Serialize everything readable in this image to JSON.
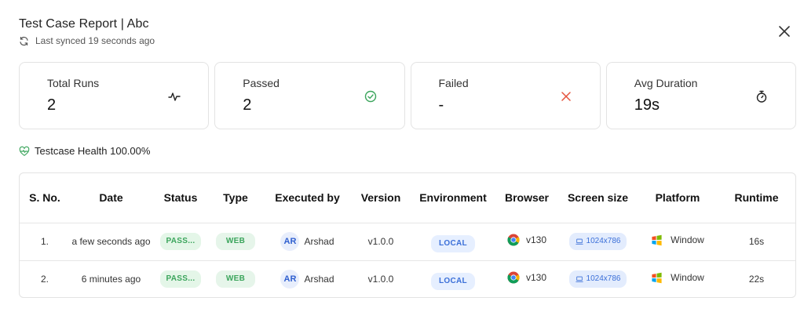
{
  "header": {
    "title": "Test Case Report | Abc",
    "sync_text": "Last synced 19 seconds ago"
  },
  "cards": [
    {
      "label": "Total Runs",
      "value": "2",
      "icon": "activity-icon"
    },
    {
      "label": "Passed",
      "value": "2",
      "icon": "check-circle-icon"
    },
    {
      "label": "Failed",
      "value": "-",
      "icon": "x-icon"
    },
    {
      "label": "Avg Duration",
      "value": "19s",
      "icon": "stopwatch-icon"
    }
  ],
  "health": {
    "text": "Testcase Health 100.00%"
  },
  "table": {
    "headers": [
      "S. No.",
      "Date",
      "Status",
      "Type",
      "Executed by",
      "Version",
      "Environment",
      "Browser",
      "Screen size",
      "Platform",
      "Runtime"
    ],
    "rows": [
      {
        "sno": "1.",
        "date": "a few seconds ago",
        "status": "PASS...",
        "type": "WEB",
        "avatar": "AR",
        "executed_by": "Arshad",
        "version": "v1.0.0",
        "environment": "LOCAL",
        "browser": "v130",
        "screen_size": "1024x786",
        "platform": "Window",
        "runtime": "16s"
      },
      {
        "sno": "2.",
        "date": "6 minutes ago",
        "status": "PASS...",
        "type": "WEB",
        "avatar": "AR",
        "executed_by": "Arshad",
        "version": "v1.0.0",
        "environment": "LOCAL",
        "browser": "v130",
        "screen_size": "1024x786",
        "platform": "Window",
        "runtime": "22s"
      }
    ]
  },
  "colors": {
    "pass_green": "#3ba55c",
    "fail_red": "#e5533d",
    "local_blue": "#3b6fd8"
  }
}
